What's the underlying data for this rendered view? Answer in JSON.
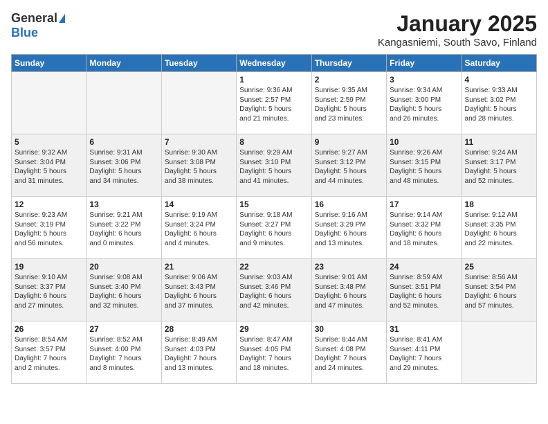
{
  "header": {
    "logo_general": "General",
    "logo_blue": "Blue",
    "title": "January 2025",
    "subtitle": "Kangasniemi, South Savo, Finland"
  },
  "weekdays": [
    "Sunday",
    "Monday",
    "Tuesday",
    "Wednesday",
    "Thursday",
    "Friday",
    "Saturday"
  ],
  "weeks": [
    [
      {
        "day": "",
        "content": ""
      },
      {
        "day": "",
        "content": ""
      },
      {
        "day": "",
        "content": ""
      },
      {
        "day": "1",
        "content": "Sunrise: 9:36 AM\nSunset: 2:57 PM\nDaylight: 5 hours\nand 21 minutes."
      },
      {
        "day": "2",
        "content": "Sunrise: 9:35 AM\nSunset: 2:59 PM\nDaylight: 5 hours\nand 23 minutes."
      },
      {
        "day": "3",
        "content": "Sunrise: 9:34 AM\nSunset: 3:00 PM\nDaylight: 5 hours\nand 26 minutes."
      },
      {
        "day": "4",
        "content": "Sunrise: 9:33 AM\nSunset: 3:02 PM\nDaylight: 5 hours\nand 28 minutes."
      }
    ],
    [
      {
        "day": "5",
        "content": "Sunrise: 9:32 AM\nSunset: 3:04 PM\nDaylight: 5 hours\nand 31 minutes."
      },
      {
        "day": "6",
        "content": "Sunrise: 9:31 AM\nSunset: 3:06 PM\nDaylight: 5 hours\nand 34 minutes."
      },
      {
        "day": "7",
        "content": "Sunrise: 9:30 AM\nSunset: 3:08 PM\nDaylight: 5 hours\nand 38 minutes."
      },
      {
        "day": "8",
        "content": "Sunrise: 9:29 AM\nSunset: 3:10 PM\nDaylight: 5 hours\nand 41 minutes."
      },
      {
        "day": "9",
        "content": "Sunrise: 9:27 AM\nSunset: 3:12 PM\nDaylight: 5 hours\nand 44 minutes."
      },
      {
        "day": "10",
        "content": "Sunrise: 9:26 AM\nSunset: 3:15 PM\nDaylight: 5 hours\nand 48 minutes."
      },
      {
        "day": "11",
        "content": "Sunrise: 9:24 AM\nSunset: 3:17 PM\nDaylight: 5 hours\nand 52 minutes."
      }
    ],
    [
      {
        "day": "12",
        "content": "Sunrise: 9:23 AM\nSunset: 3:19 PM\nDaylight: 5 hours\nand 56 minutes."
      },
      {
        "day": "13",
        "content": "Sunrise: 9:21 AM\nSunset: 3:22 PM\nDaylight: 6 hours\nand 0 minutes."
      },
      {
        "day": "14",
        "content": "Sunrise: 9:19 AM\nSunset: 3:24 PM\nDaylight: 6 hours\nand 4 minutes."
      },
      {
        "day": "15",
        "content": "Sunrise: 9:18 AM\nSunset: 3:27 PM\nDaylight: 6 hours\nand 9 minutes."
      },
      {
        "day": "16",
        "content": "Sunrise: 9:16 AM\nSunset: 3:29 PM\nDaylight: 6 hours\nand 13 minutes."
      },
      {
        "day": "17",
        "content": "Sunrise: 9:14 AM\nSunset: 3:32 PM\nDaylight: 6 hours\nand 18 minutes."
      },
      {
        "day": "18",
        "content": "Sunrise: 9:12 AM\nSunset: 3:35 PM\nDaylight: 6 hours\nand 22 minutes."
      }
    ],
    [
      {
        "day": "19",
        "content": "Sunrise: 9:10 AM\nSunset: 3:37 PM\nDaylight: 6 hours\nand 27 minutes."
      },
      {
        "day": "20",
        "content": "Sunrise: 9:08 AM\nSunset: 3:40 PM\nDaylight: 6 hours\nand 32 minutes."
      },
      {
        "day": "21",
        "content": "Sunrise: 9:06 AM\nSunset: 3:43 PM\nDaylight: 6 hours\nand 37 minutes."
      },
      {
        "day": "22",
        "content": "Sunrise: 9:03 AM\nSunset: 3:46 PM\nDaylight: 6 hours\nand 42 minutes."
      },
      {
        "day": "23",
        "content": "Sunrise: 9:01 AM\nSunset: 3:48 PM\nDaylight: 6 hours\nand 47 minutes."
      },
      {
        "day": "24",
        "content": "Sunrise: 8:59 AM\nSunset: 3:51 PM\nDaylight: 6 hours\nand 52 minutes."
      },
      {
        "day": "25",
        "content": "Sunrise: 8:56 AM\nSunset: 3:54 PM\nDaylight: 6 hours\nand 57 minutes."
      }
    ],
    [
      {
        "day": "26",
        "content": "Sunrise: 8:54 AM\nSunset: 3:57 PM\nDaylight: 7 hours\nand 2 minutes."
      },
      {
        "day": "27",
        "content": "Sunrise: 8:52 AM\nSunset: 4:00 PM\nDaylight: 7 hours\nand 8 minutes."
      },
      {
        "day": "28",
        "content": "Sunrise: 8:49 AM\nSunset: 4:03 PM\nDaylight: 7 hours\nand 13 minutes."
      },
      {
        "day": "29",
        "content": "Sunrise: 8:47 AM\nSunset: 4:05 PM\nDaylight: 7 hours\nand 18 minutes."
      },
      {
        "day": "30",
        "content": "Sunrise: 8:44 AM\nSunset: 4:08 PM\nDaylight: 7 hours\nand 24 minutes."
      },
      {
        "day": "31",
        "content": "Sunrise: 8:41 AM\nSunset: 4:11 PM\nDaylight: 7 hours\nand 29 minutes."
      },
      {
        "day": "",
        "content": ""
      }
    ]
  ]
}
